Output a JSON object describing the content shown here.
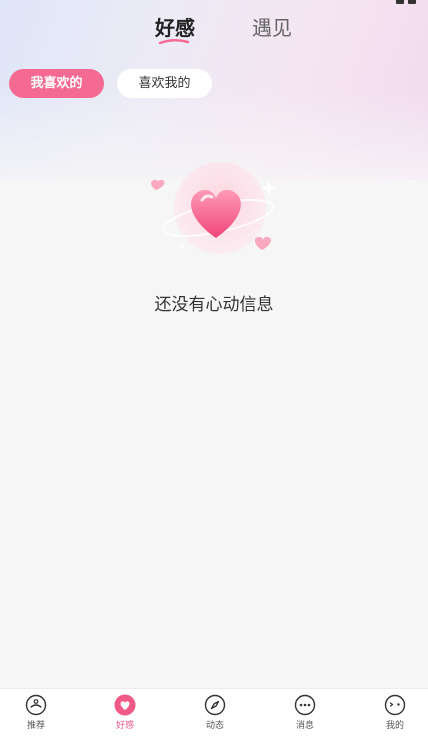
{
  "header": {
    "tabs": [
      {
        "label": "好感",
        "active": true
      },
      {
        "label": "遇见",
        "active": false
      }
    ]
  },
  "filters": {
    "chips": [
      {
        "label": "我喜欢的",
        "active": true
      },
      {
        "label": "喜欢我的",
        "active": false
      }
    ]
  },
  "empty_state": {
    "message": "还没有心动信息",
    "icon": "heart-illustration-icon"
  },
  "bottom_nav": {
    "items": [
      {
        "label": "推荐",
        "icon": "recommend-icon",
        "active": false
      },
      {
        "label": "好感",
        "icon": "heart-icon",
        "active": true
      },
      {
        "label": "动态",
        "icon": "compass-icon",
        "active": false
      },
      {
        "label": "消息",
        "icon": "chat-bubble-icon",
        "active": false
      },
      {
        "label": "我的",
        "icon": "profile-face-icon",
        "active": false
      }
    ]
  },
  "colors": {
    "accent": "#f46a93",
    "active_nav": "#f05a89",
    "background": "#f6f6f7"
  }
}
